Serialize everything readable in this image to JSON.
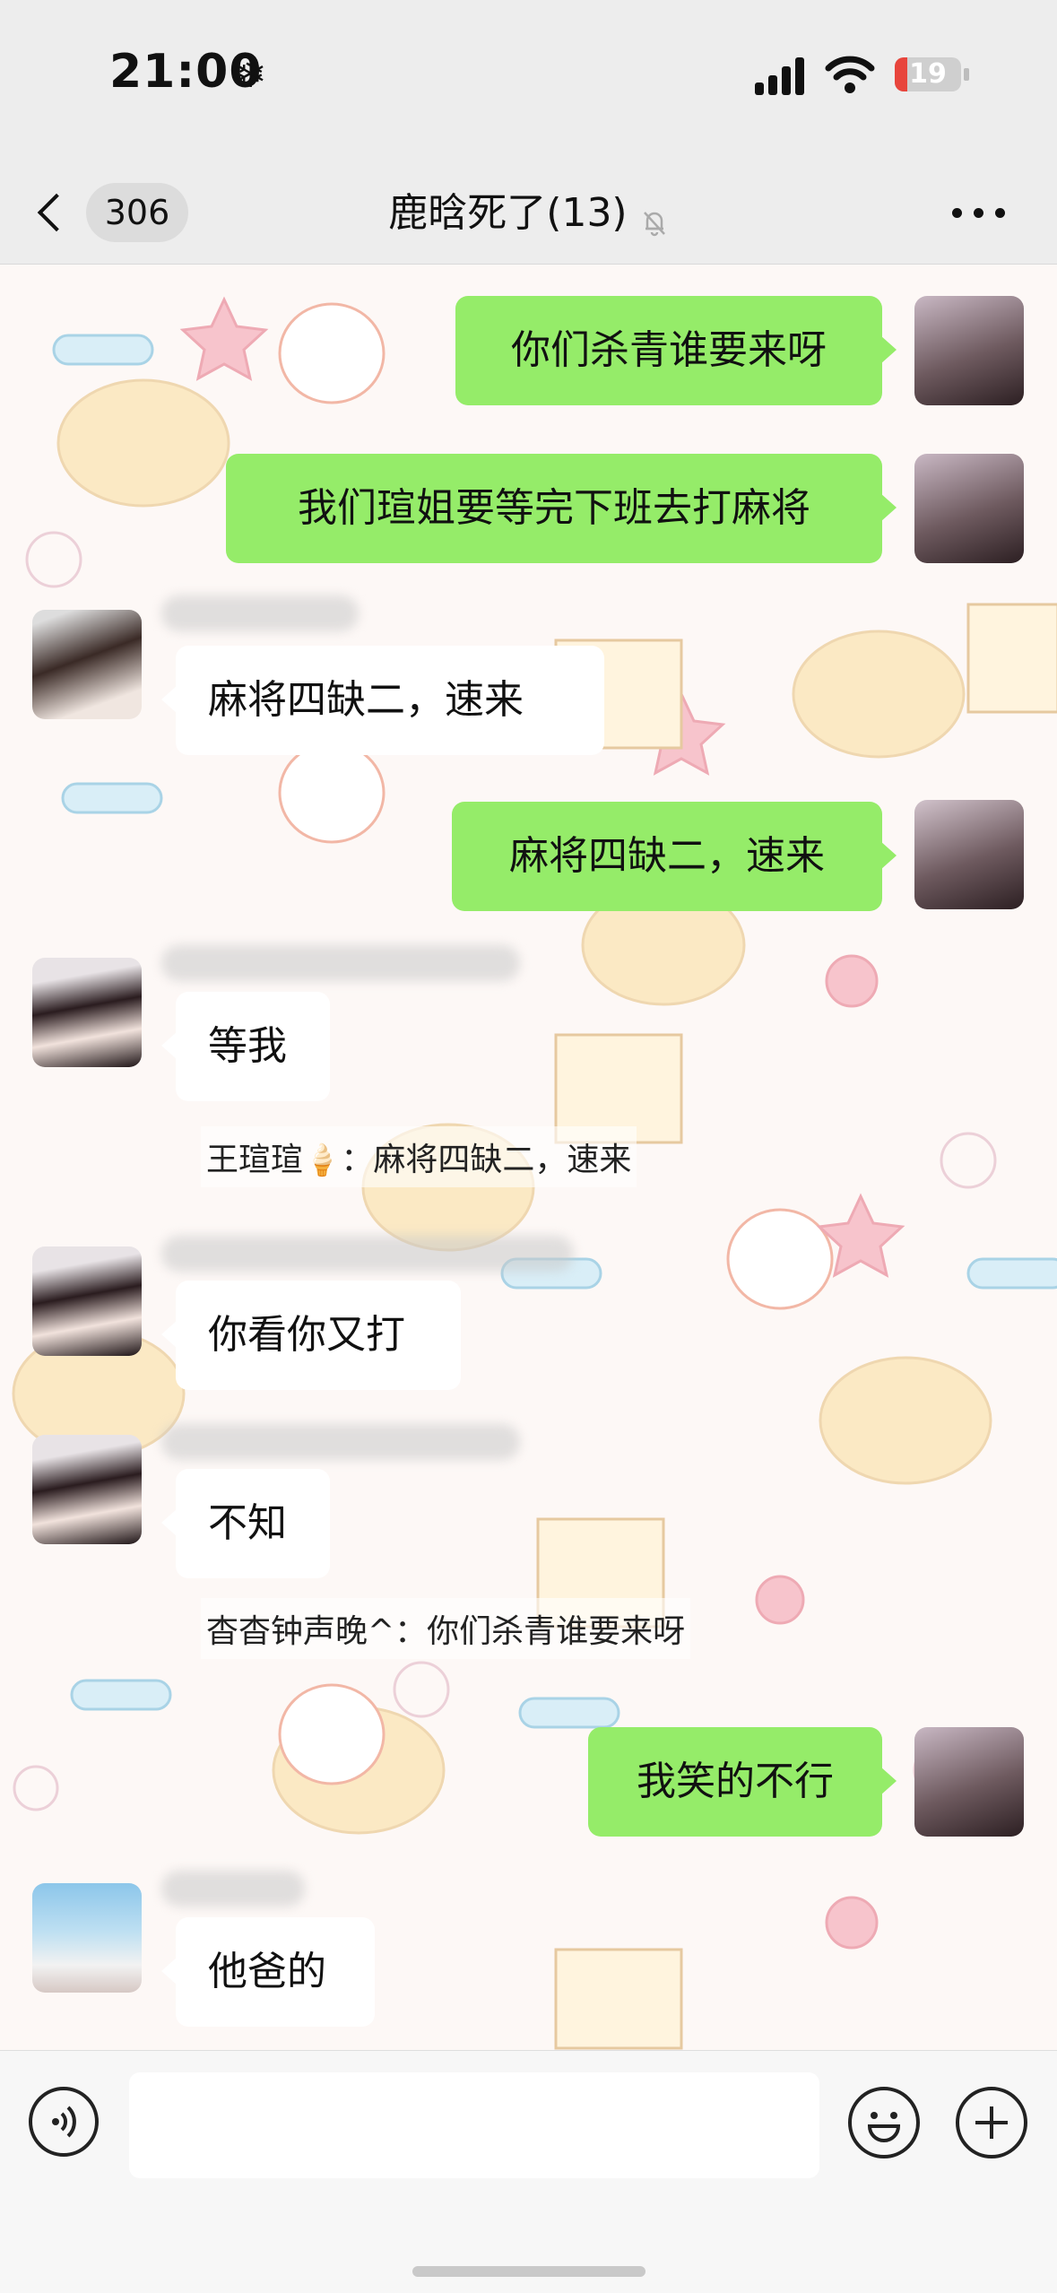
{
  "status_bar": {
    "time": "21:00",
    "time_icon": "snowflake-icon",
    "battery_level": "19",
    "battery_color": "#e8453c",
    "battery_fraction": 0.19
  },
  "nav": {
    "unread_count": "306",
    "title": "鹿晗死了(13)",
    "mute_icon": "bell-slash-icon"
  },
  "messages": [
    {
      "side": "right",
      "text": "你们杀青谁要来呀"
    },
    {
      "side": "right",
      "text": "我们瑄姐要等完下班去打麻将"
    },
    {
      "side": "left",
      "text": "麻将四缺二，速来"
    },
    {
      "side": "right",
      "text": "麻将四缺二，速来"
    },
    {
      "side": "left",
      "text": "等我"
    },
    {
      "side": "quote",
      "sender": "王瑄瑄",
      "emoji": "🍦",
      "text": "：麻将四缺二，速来"
    },
    {
      "side": "left",
      "text": "你看你又打"
    },
    {
      "side": "left",
      "text": "不知"
    },
    {
      "side": "quote",
      "sender": "杳杳钟声晚^",
      "text": "：你们杀青谁要来呀"
    },
    {
      "side": "right",
      "text": "我笑的不行"
    },
    {
      "side": "left",
      "text": "他爸的"
    }
  ],
  "input_bar": {
    "voice_icon": "voice-icon",
    "emoji_icon": "smiley-icon",
    "plus_icon": "plus-icon",
    "input_value": ""
  },
  "colors": {
    "bubble_right": "#95ec69",
    "bubble_left": "#ffffff",
    "nav_bg": "#ededed"
  }
}
